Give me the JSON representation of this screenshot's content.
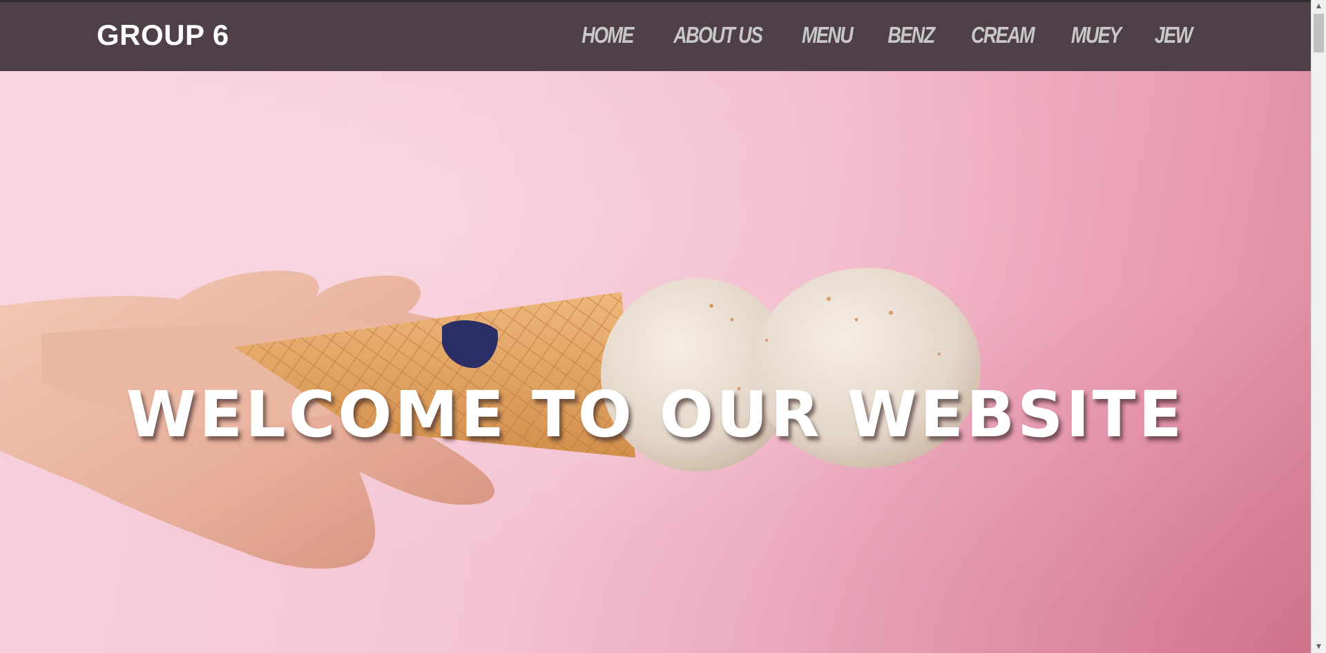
{
  "brand": {
    "name": "GROUP 6"
  },
  "nav": {
    "items": [
      {
        "label": "HOME"
      },
      {
        "label": "ABOUT US"
      },
      {
        "label": "MENU"
      },
      {
        "label": "BENZ"
      },
      {
        "label": "CREAM"
      },
      {
        "label": "MUEY"
      },
      {
        "label": "JEW"
      }
    ]
  },
  "hero": {
    "title": "WELCOME TO OUR WEBSITE",
    "image": "ice-cream-cone-hand-pink-background"
  },
  "colors": {
    "navbar": "#4f3f49",
    "nav_text": "#c8c8c8",
    "brand_text": "#ffffff",
    "hero_bg": "#f2b9cb"
  },
  "scrollbar": {
    "up_icon": "scroll-up-arrow-icon",
    "down_icon": "scroll-down-arrow-icon"
  }
}
